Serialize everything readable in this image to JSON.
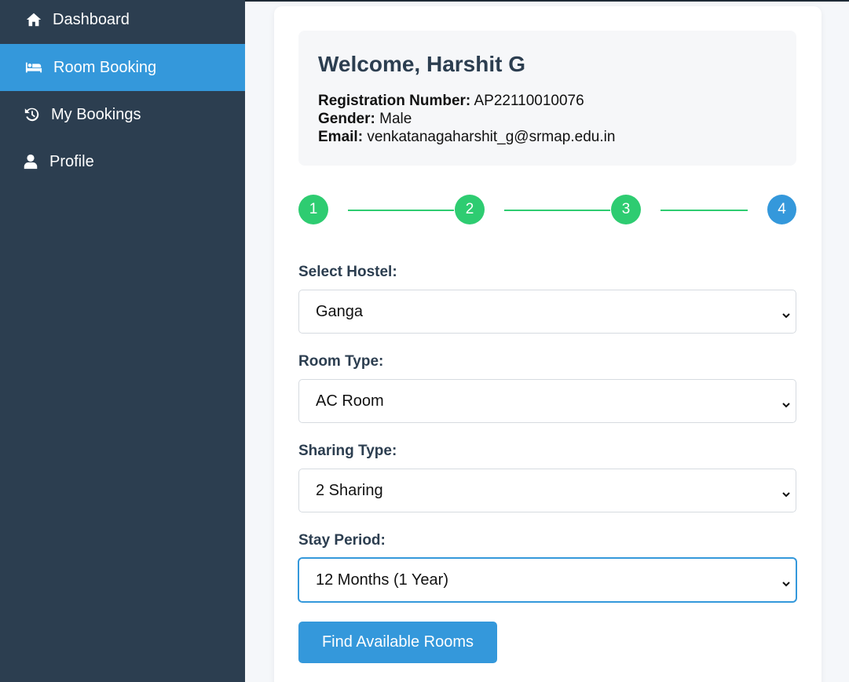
{
  "sidebar": {
    "items": [
      {
        "label": "Dashboard",
        "icon": "home-icon",
        "active": false
      },
      {
        "label": "Room Booking",
        "icon": "bed-icon",
        "active": true
      },
      {
        "label": "My Bookings",
        "icon": "history-icon",
        "active": false
      },
      {
        "label": "Profile",
        "icon": "user-icon",
        "active": false
      }
    ]
  },
  "welcome": {
    "title": "Welcome, Harshit G",
    "registration_label": "Registration Number:",
    "registration_value": "AP22110010076",
    "gender_label": "Gender:",
    "gender_value": "Male",
    "email_label": "Email:",
    "email_value": "venkatanagaharshit_g@srmap.edu.in"
  },
  "steps": [
    {
      "label": "1",
      "state": "done"
    },
    {
      "label": "2",
      "state": "done"
    },
    {
      "label": "3",
      "state": "done"
    },
    {
      "label": "4",
      "state": "current"
    }
  ],
  "form": {
    "hostel_label": "Select Hostel:",
    "hostel_value": "Ganga",
    "room_type_label": "Room Type:",
    "room_type_value": "AC Room",
    "sharing_label": "Sharing Type:",
    "sharing_value": "2 Sharing",
    "stay_label": "Stay Period:",
    "stay_value": "12 Months (1 Year)",
    "submit_label": "Find Available Rooms"
  },
  "colors": {
    "sidebar_bg": "#2c3e50",
    "accent": "#3498db",
    "step_done": "#2ecc71"
  }
}
